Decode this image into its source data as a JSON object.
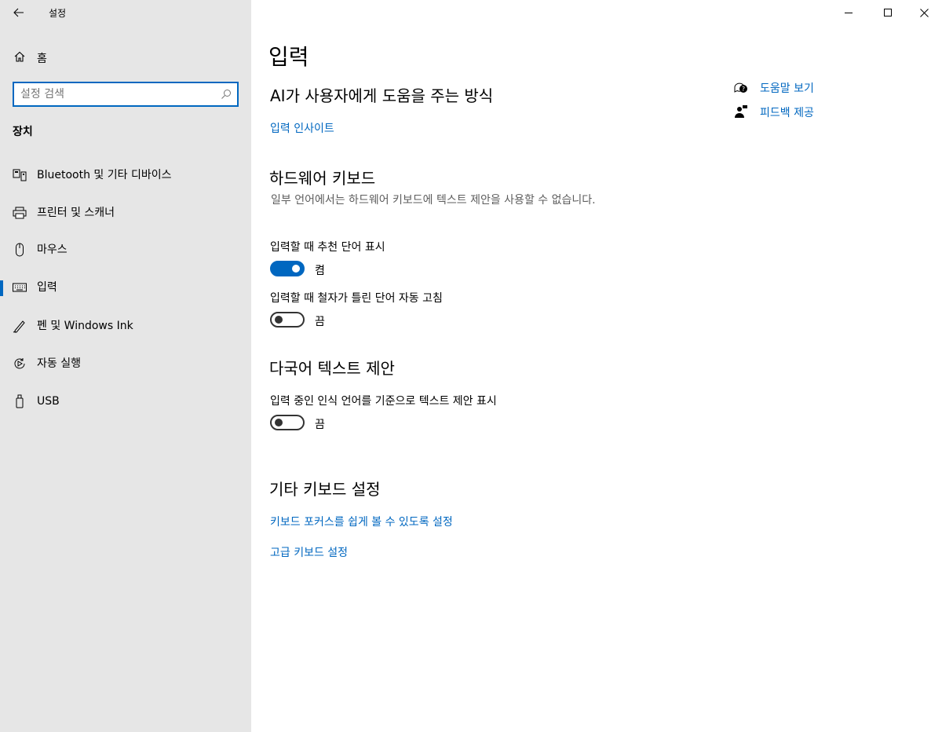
{
  "window": {
    "title": "설정",
    "icons": {
      "back": "back-arrow-icon",
      "minimize": "minimize-icon",
      "maximize": "maximize-icon",
      "close": "close-icon"
    }
  },
  "sidebar": {
    "home_label": "홈",
    "search_placeholder": "설정 검색",
    "category": "장치",
    "items": [
      {
        "label": "Bluetooth 및 기타 디바이스",
        "icon": "bluetooth-devices-icon",
        "selected": false
      },
      {
        "label": "프린터 및 스캐너",
        "icon": "printer-icon",
        "selected": false
      },
      {
        "label": "마우스",
        "icon": "mouse-icon",
        "selected": false
      },
      {
        "label": "입력",
        "icon": "keyboard-icon",
        "selected": true
      },
      {
        "label": "펜 및 Windows Ink",
        "icon": "pen-icon",
        "selected": false
      },
      {
        "label": "자동 실행",
        "icon": "autoplay-icon",
        "selected": false
      },
      {
        "label": "USB",
        "icon": "usb-icon",
        "selected": false
      }
    ]
  },
  "main": {
    "page_title": "입력",
    "ai_section": {
      "title": "AI가 사용자에게 도움을 주는 방식",
      "link": "입력 인사이트"
    },
    "hw_section": {
      "title": "하드웨어 키보드",
      "description": "일부 언어에서는 하드웨어 키보드에 텍스트 제안을 사용할 수 없습니다.",
      "options": [
        {
          "label": "입력할 때 추천 단어 표시",
          "state": "켬",
          "on": true
        },
        {
          "label": "입력할 때 철자가 틀린 단어 자동 고침",
          "state": "끔",
          "on": false
        }
      ]
    },
    "multi_section": {
      "title": "다국어 텍스트 제안",
      "options": [
        {
          "label": "입력 중인 인식 언어를 기준으로 텍스트 제안 표시",
          "state": "끔",
          "on": false
        }
      ]
    },
    "other_section": {
      "title": "기타 키보드 설정",
      "links": [
        "키보드 포커스를 쉽게 볼 수 있도록 설정",
        "고급 키보드 설정"
      ]
    },
    "right_links": [
      {
        "label": "도움말 보기",
        "icon": "help-chat-icon"
      },
      {
        "label": "피드백 제공",
        "icon": "feedback-person-icon"
      }
    ]
  },
  "colors": {
    "accent": "#0067c0",
    "sidebar_bg": "#e6e6e6",
    "description_text": "#5d5d5d"
  }
}
